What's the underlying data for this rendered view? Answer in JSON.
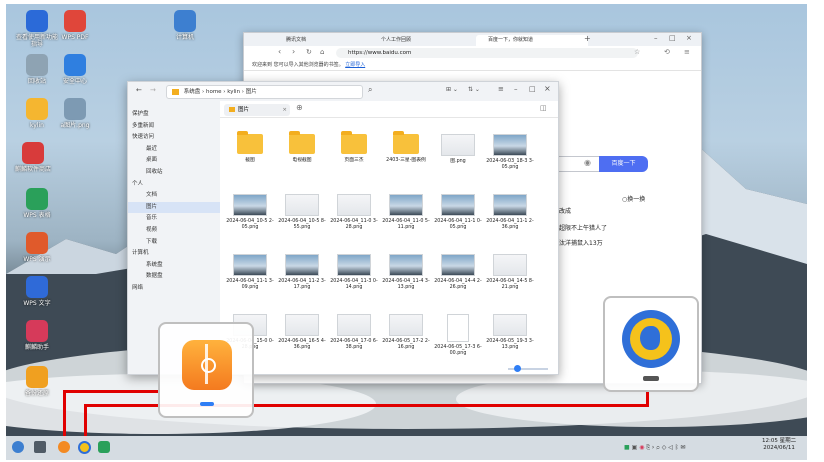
{
  "desktop": {
    "icons": [
      {
        "label": "查看使用新功能指导",
        "icon": "kylin-logo-icon",
        "color": "#2b6ad8"
      },
      {
        "label": "WPS PDF",
        "icon": "wps-pdf-icon",
        "color": "#e0463a"
      },
      {
        "label": "计算机",
        "icon": "computer-icon",
        "color": "#3d7fd0"
      },
      {
        "label": "回收站",
        "icon": "trash-icon",
        "color": "#8ea3b3"
      },
      {
        "label": "安全中心",
        "icon": "security-shield-icon",
        "color": "#2f7fe0"
      },
      {
        "label": "kylin",
        "icon": "home-folder-icon",
        "color": "#f5b630"
      },
      {
        "label": "a图片.png",
        "icon": "image-file-icon",
        "color": "#7d9ab3"
      },
      {
        "label": "麒麟软件商店",
        "icon": "software-store-icon",
        "color": "#d83b3b"
      },
      {
        "label": "WPS 表格",
        "icon": "wps-sheet-icon",
        "color": "#2aa05a"
      },
      {
        "label": "WPS 演示",
        "icon": "wps-presentation-icon",
        "color": "#e05a2b"
      },
      {
        "label": "WPS 文字",
        "icon": "wps-writer-icon",
        "color": "#2f6ad8"
      },
      {
        "label": "麒麟助手",
        "icon": "assistant-icon",
        "color": "#d63a5a"
      },
      {
        "label": "备份还原",
        "icon": "backup-restore-icon",
        "color": "#f0a020"
      }
    ]
  },
  "browser": {
    "tabs": [
      {
        "label": "腾讯文档",
        "active": false
      },
      {
        "label": "个人工作回顾",
        "active": false
      },
      {
        "label": "百度一下，你就知道",
        "active": true
      }
    ],
    "url": "https://www.baidu.com",
    "bookmark_text": "欢迎来到 您可以导入其他浏览器的书签。",
    "bookmark_link": "立即导入",
    "baidu_button": "百度一下",
    "side_texts": [
      "○换一换",
      "改成",
      "超限不上午猎人了",
      "汰洋捕鼠入13万"
    ]
  },
  "file_manager": {
    "path": [
      "系统盘",
      "home",
      "kylin",
      "图片"
    ],
    "tab_label": "图片",
    "sidebar": [
      {
        "label": "保护盘",
        "sel": false
      },
      {
        "label": "多重新闻",
        "sel": false
      },
      {
        "label": "快速访问",
        "sel": false
      },
      {
        "label": "最近",
        "sel": false
      },
      {
        "label": "桌面",
        "sel": false
      },
      {
        "label": "回收站",
        "sel": false
      },
      {
        "label": "个人",
        "sel": false
      },
      {
        "label": "文档",
        "sel": false
      },
      {
        "label": "图片",
        "sel": true
      },
      {
        "label": "音乐",
        "sel": false
      },
      {
        "label": "视频",
        "sel": false
      },
      {
        "label": "下载",
        "sel": false
      },
      {
        "label": "计算机",
        "sel": false
      },
      {
        "label": "系统盘",
        "sel": false
      },
      {
        "label": "数据盘",
        "sel": false
      },
      {
        "label": "网络",
        "sel": false
      }
    ],
    "items": [
      {
        "name": "截图",
        "kind": "folder"
      },
      {
        "name": "电视截图",
        "kind": "folder"
      },
      {
        "name": "页面三杰",
        "kind": "folder"
      },
      {
        "name": "2403-三星-图表例",
        "kind": "folder"
      },
      {
        "name": "图.png",
        "kind": "light"
      },
      {
        "name": "2024-06-03_18-3 3-05.png",
        "kind": "thumb"
      },
      {
        "name": "2024-06-04_10-5 2-05.png",
        "kind": "thumb"
      },
      {
        "name": "2024-06-04_10-5 8-55.png",
        "kind": "light"
      },
      {
        "name": "2024-06-04_11-0 3-28.png",
        "kind": "light"
      },
      {
        "name": "2024-06-04_11-0 5-11.png",
        "kind": "thumb"
      },
      {
        "name": "2024-06-04_11-1 0-05.png",
        "kind": "thumb"
      },
      {
        "name": "2024-06-04_11-1 2-36.png",
        "kind": "thumb"
      },
      {
        "name": "2024-06-04_11-1 3-09.png",
        "kind": "thumb"
      },
      {
        "name": "2024-06-04_11-2 3-17.png",
        "kind": "thumb"
      },
      {
        "name": "2024-06-04_11-3 0-14.png",
        "kind": "thumb"
      },
      {
        "name": "2024-06-04_11-4 3-13.png",
        "kind": "thumb"
      },
      {
        "name": "2024-06-04_14-4 2-26.png",
        "kind": "thumb"
      },
      {
        "name": "2024-06-04_14-5 8-21.png",
        "kind": "light"
      },
      {
        "name": "2024-06-04_15-0 0-28.png",
        "kind": "light"
      },
      {
        "name": "2024-06-04_16-5 4-36.png",
        "kind": "light"
      },
      {
        "name": "2024-06-04_17-0 6-38.png",
        "kind": "light"
      },
      {
        "name": "2024-06-05_17-2 2-16.png",
        "kind": "light"
      },
      {
        "name": "2024-06-05_17-3 6-00.png",
        "kind": "doc"
      },
      {
        "name": "2024-06-05_19-3 3-13.png",
        "kind": "light"
      }
    ]
  },
  "taskbar": {
    "clock_time": "12:05 星期二",
    "clock_date": "2024/06/11"
  },
  "accent_colors": {
    "red_line": "#e00000",
    "baidu_blue": "#4e6ef2",
    "folder": "#f8c13b"
  }
}
